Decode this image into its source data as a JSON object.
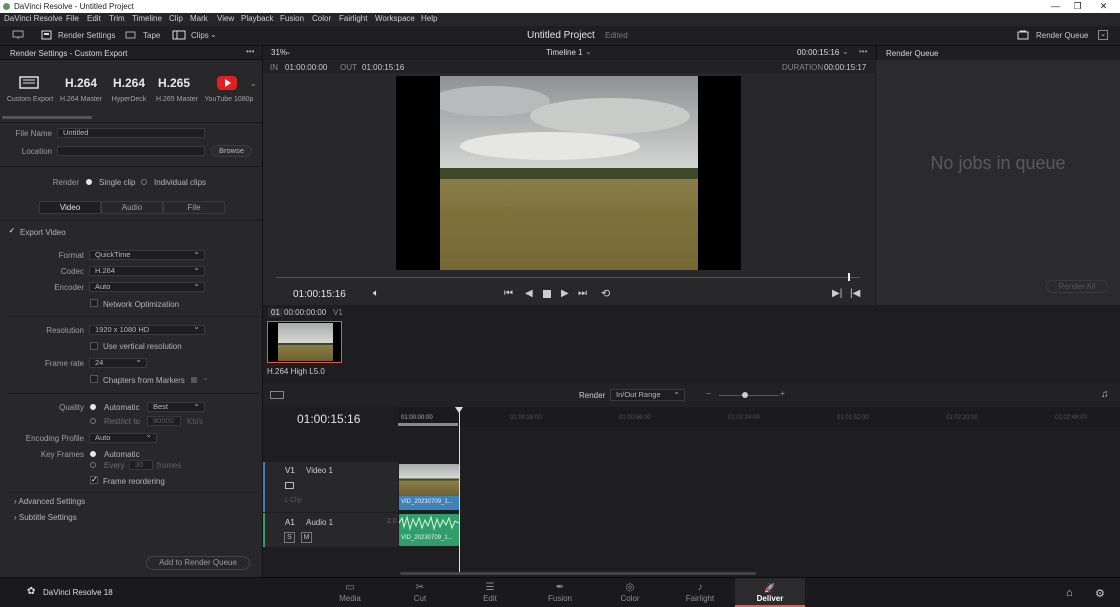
{
  "window": {
    "title": "DaVinci Resolve - Untitled Project",
    "controls": [
      "—",
      "❐",
      "✕"
    ]
  },
  "menu": [
    "DaVinci Resolve",
    "File",
    "Edit",
    "Trim",
    "Timeline",
    "Clip",
    "Mark",
    "View",
    "Playback",
    "Fusion",
    "Color",
    "Fairlight",
    "Workspace",
    "Help"
  ],
  "toolbar": {
    "render_settings": "Render Settings",
    "tape": "Tape",
    "clips": "Clips",
    "project_title": "Untitled Project",
    "edited": "Edited",
    "render_queue": "Render Queue"
  },
  "left": {
    "header": "Render Settings - Custom Export",
    "presets": [
      {
        "big": "",
        "label": "Custom Export"
      },
      {
        "big": "H.264",
        "label": "H.264 Master"
      },
      {
        "big": "H.264",
        "label": "HyperDeck"
      },
      {
        "big": "H.265",
        "label": "H.265 Master"
      },
      {
        "big": "",
        "label": "YouTube 1080p"
      }
    ],
    "file_name_label": "File Name",
    "file_name": "Untitled",
    "location_label": "Location",
    "location": "",
    "browse": "Browse",
    "render_label": "Render",
    "single_clip": "Single clip",
    "individual_clips": "Individual clips",
    "tabs": [
      "Video",
      "Audio",
      "File"
    ],
    "export_video": "Export Video",
    "format_label": "Format",
    "format": "QuickTime",
    "codec_label": "Codec",
    "codec": "H.264",
    "encoder_label": "Encoder",
    "encoder": "Auto",
    "network_opt": "Network Optimization",
    "resolution_label": "Resolution",
    "resolution": "1920 x 1080 HD",
    "vertical_res": "Use vertical resolution",
    "framerate_label": "Frame rate",
    "framerate": "24",
    "chapters": "Chapters from Markers",
    "quality_label": "Quality",
    "automatic": "Automatic",
    "best": "Best",
    "restrict_to": "Restrict to",
    "restrict_value": "80000",
    "kbs": "Kb/s",
    "encoding_profile_label": "Encoding Profile",
    "encoding_profile": "Auto",
    "key_frames_label": "Key Frames",
    "kf_automatic": "Automatic",
    "every": "Every",
    "every_value": "30",
    "frames": "frames",
    "frame_reordering": "Frame reordering",
    "advanced": "Advanced Settings",
    "subtitle": "Subtitle Settings",
    "add_queue": "Add to Render Queue"
  },
  "viewer": {
    "zoom": "31%",
    "timeline": "Timeline 1",
    "tc_top": "00:00:15:16",
    "in_label": "IN",
    "in_tc": "01:00:00:00",
    "out_label": "OUT",
    "out_tc": "01:00:15:16",
    "duration_label": "DURATION",
    "duration": "00:00:15:17",
    "current_tc": "01:00:15:16"
  },
  "queue": {
    "header": "Render Queue",
    "empty": "No jobs in queue",
    "render_all": "Render All"
  },
  "clip_strip": {
    "index": "01",
    "tc": "00:00:00:00",
    "track": "V1",
    "clip_label": "H.264 High L5.0"
  },
  "timeline": {
    "render_label": "Render",
    "range": "In/Out Range",
    "tc": "01:00:15:16",
    "ruler": [
      "01:00:00:00",
      "01:00:28:00",
      "01:00:56:00",
      "01:01:24:00",
      "01:01:52:00",
      "01:02:20:00",
      "01:02:48:00"
    ],
    "v1": "V1",
    "video1": "Video 1",
    "clip_count": "1 Clip",
    "a1": "A1",
    "audio1": "Audio 1",
    "a_level": "2.0",
    "s": "S",
    "m": "M",
    "video_clip": "VID_20230709_1...",
    "audio_clip": "VID_20230709_1..."
  },
  "bottom": {
    "app": "DaVinci Resolve 18",
    "pages": [
      {
        "icon": "▭",
        "label": "Media"
      },
      {
        "icon": "✂",
        "label": "Cut"
      },
      {
        "icon": "☰",
        "label": "Edit"
      },
      {
        "icon": "✒",
        "label": "Fusion"
      },
      {
        "icon": "◎",
        "label": "Color"
      },
      {
        "icon": "♪",
        "label": "Fairlight"
      },
      {
        "icon": "🚀",
        "label": "Deliver"
      }
    ],
    "active": "Deliver"
  },
  "colors": {
    "accent": "#e45a4f",
    "active_tab": "#2b2b2e",
    "video_clip": "#3f82b8",
    "audio_clip": "#2f9e6a"
  }
}
